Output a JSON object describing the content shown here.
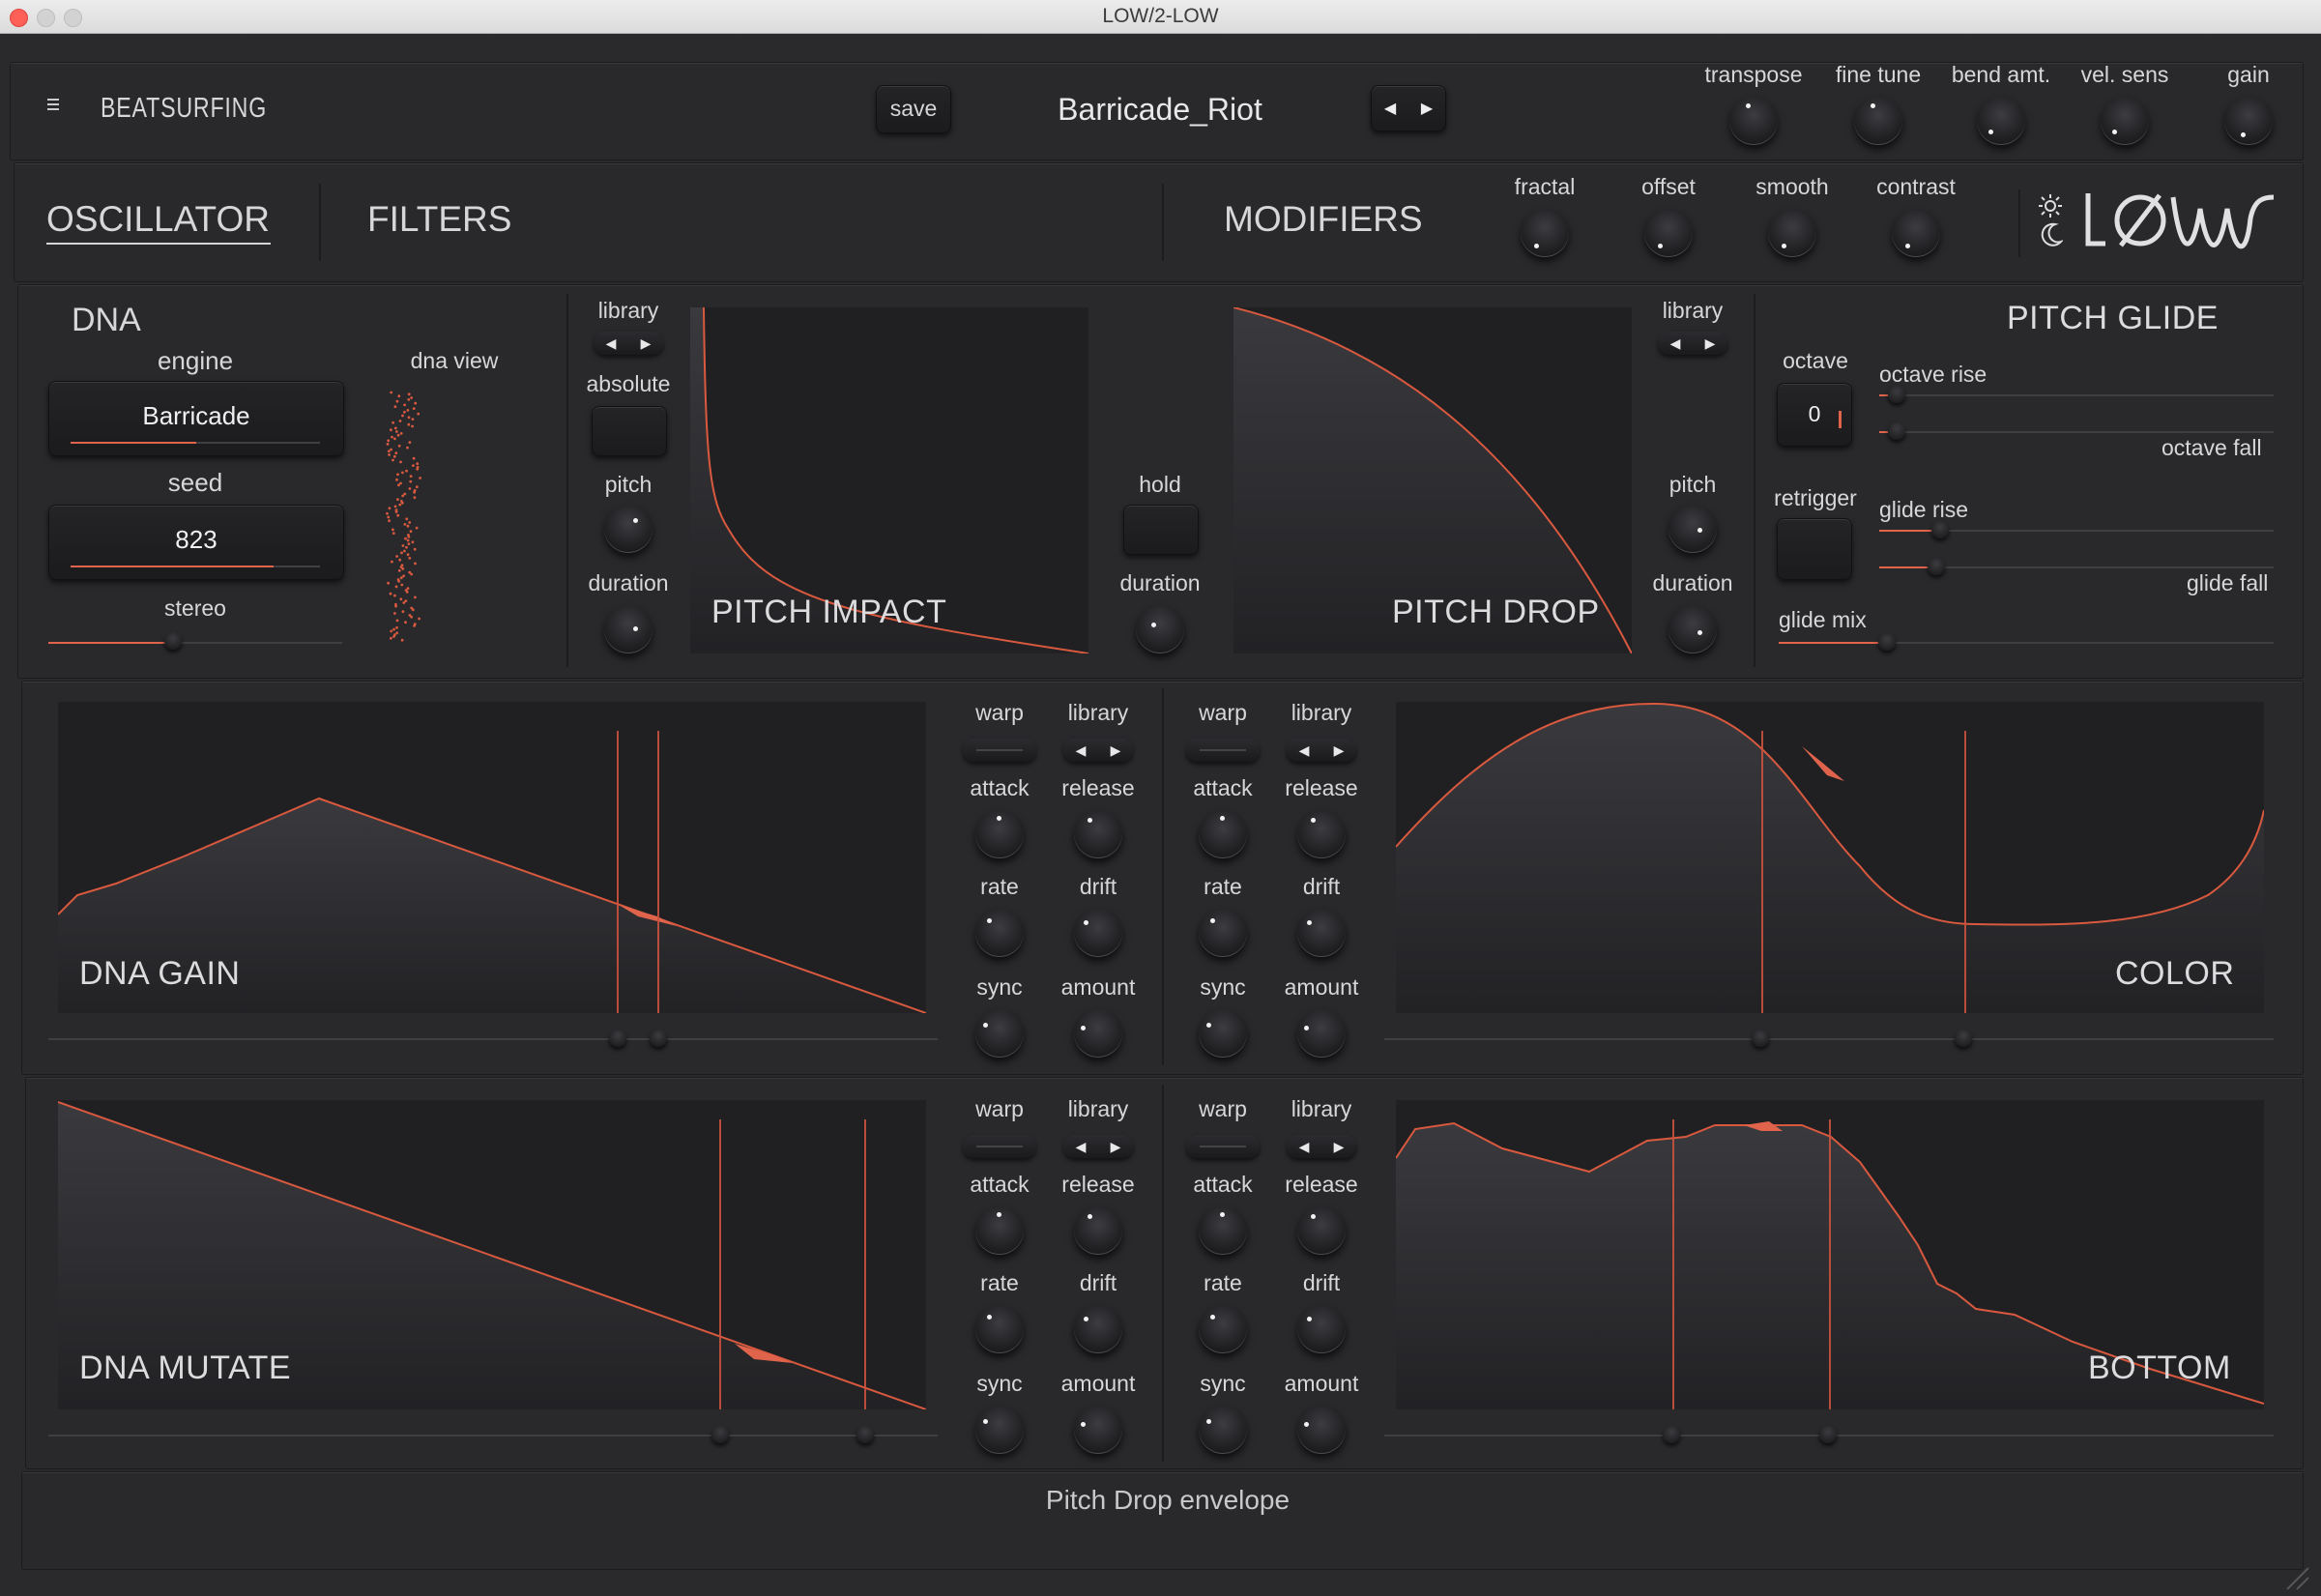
{
  "window": {
    "title": "LOW/2-LOW"
  },
  "header": {
    "brand": "BEATSURFING",
    "save_label": "save",
    "preset_name": "Barricade_Riot",
    "knobs": [
      "transpose",
      "fine tune",
      "bend amt.",
      "vel. sens",
      "gain"
    ]
  },
  "nav": {
    "tabs": [
      "OSCILLATOR",
      "FILTERS",
      "MODIFIERS"
    ],
    "active": "OSCILLATOR",
    "modifier_knobs": [
      "fractal",
      "offset",
      "smooth",
      "contrast"
    ],
    "logo": "LØW"
  },
  "dna": {
    "title": "DNA",
    "engine_label": "engine",
    "engine_value": "Barricade",
    "seed_label": "seed",
    "seed_value": "823",
    "stereo_label": "stereo",
    "dna_view_label": "dna view"
  },
  "pitch_impact": {
    "title": "PITCH IMPACT",
    "library_label": "library",
    "absolute_label": "absolute",
    "pitch_label": "pitch",
    "duration_label": "duration",
    "hold_label": "hold",
    "hold_duration_label": "duration"
  },
  "pitch_drop": {
    "title": "PITCH DROP",
    "library_label": "library",
    "pitch_label": "pitch",
    "duration_label": "duration"
  },
  "pitch_glide": {
    "title": "PITCH GLIDE",
    "octave_label": "octave",
    "octave_value": "0",
    "octave_rise": "octave rise",
    "octave_fall": "octave fall",
    "retrigger_label": "retrigger",
    "glide_rise": "glide rise",
    "glide_fall": "glide fall",
    "glide_mix": "glide mix"
  },
  "mod_labels": {
    "warp": "warp",
    "library": "library",
    "attack": "attack",
    "release": "release",
    "rate": "rate",
    "drift": "drift",
    "sync": "sync",
    "amount": "amount"
  },
  "envelopes": {
    "dna_gain": "DNA GAIN",
    "color": "COLOR",
    "dna_mutate": "DNA MUTATE",
    "bottom": "BOTTOM"
  },
  "status": {
    "text": "Pitch Drop envelope"
  },
  "colors": {
    "accent": "#e0644c",
    "bg": "#29292c",
    "display": "#202023"
  }
}
